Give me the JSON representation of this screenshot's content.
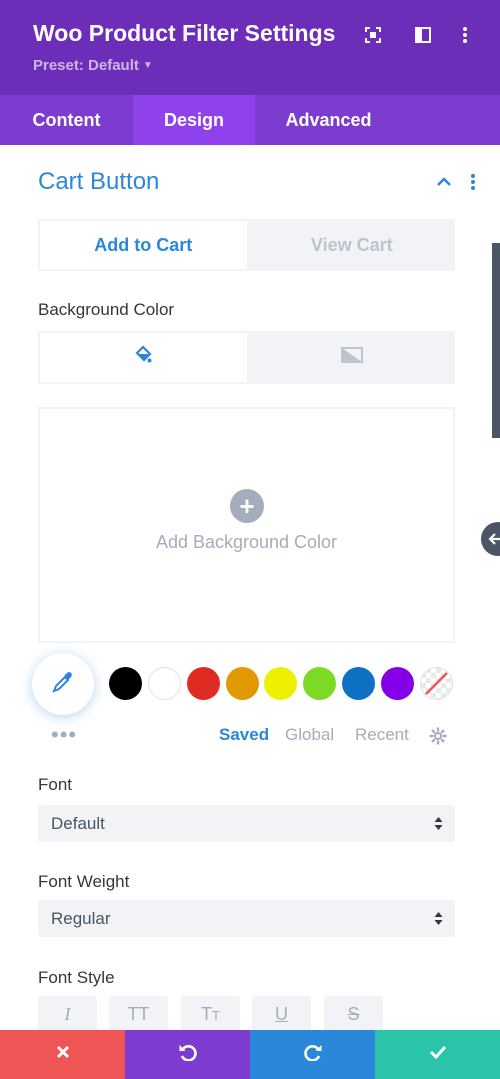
{
  "header": {
    "title": "Woo Product Filter Settings",
    "preset": "Preset: Default",
    "bg_color": "#6c2eb9",
    "icons": [
      "fullscreen-icon",
      "sidebar-layout-icon",
      "more-options-icon"
    ]
  },
  "tabs": [
    {
      "label": "Content",
      "active": false
    },
    {
      "label": "Design",
      "active": true
    },
    {
      "label": "Advanced",
      "active": false
    }
  ],
  "section": {
    "title": "Cart Button",
    "collapse_icon": "chevron-up-icon",
    "menu_icon": "kebab-icon"
  },
  "button_toggle": {
    "add_to_cart": "Add to Cart",
    "view_cart": "View Cart",
    "active": "add_to_cart"
  },
  "background": {
    "label": "Background Color",
    "types": [
      "paint-bucket-icon",
      "gradient-icon"
    ],
    "active_type": "paint-bucket-icon",
    "add_label": "Add Background Color"
  },
  "palette": {
    "swatches": [
      "#000000",
      "#ffffff",
      "#e02b20",
      "#e09900",
      "#edf000",
      "#7cda24",
      "#0c71c3",
      "#8300e9"
    ],
    "tabs": [
      {
        "label": "Saved",
        "active": true
      },
      {
        "label": "Global",
        "active": false
      },
      {
        "label": "Recent",
        "active": false
      }
    ],
    "more": "•••"
  },
  "font": {
    "label": "Font",
    "value": "Default"
  },
  "font_weight": {
    "label": "Font Weight",
    "value": "Regular"
  },
  "font_style": {
    "label": "Font Style",
    "options": [
      "italic-icon",
      "uppercase-icon",
      "capitalize-icon",
      "underline-icon",
      "strikethrough-icon"
    ]
  },
  "footer": {
    "colors": {
      "cancel": "#ef5555",
      "undo": "#7e3bd0",
      "redo": "#2b87da",
      "save": "#29c4a9"
    }
  },
  "accent_color": "#2b87da"
}
